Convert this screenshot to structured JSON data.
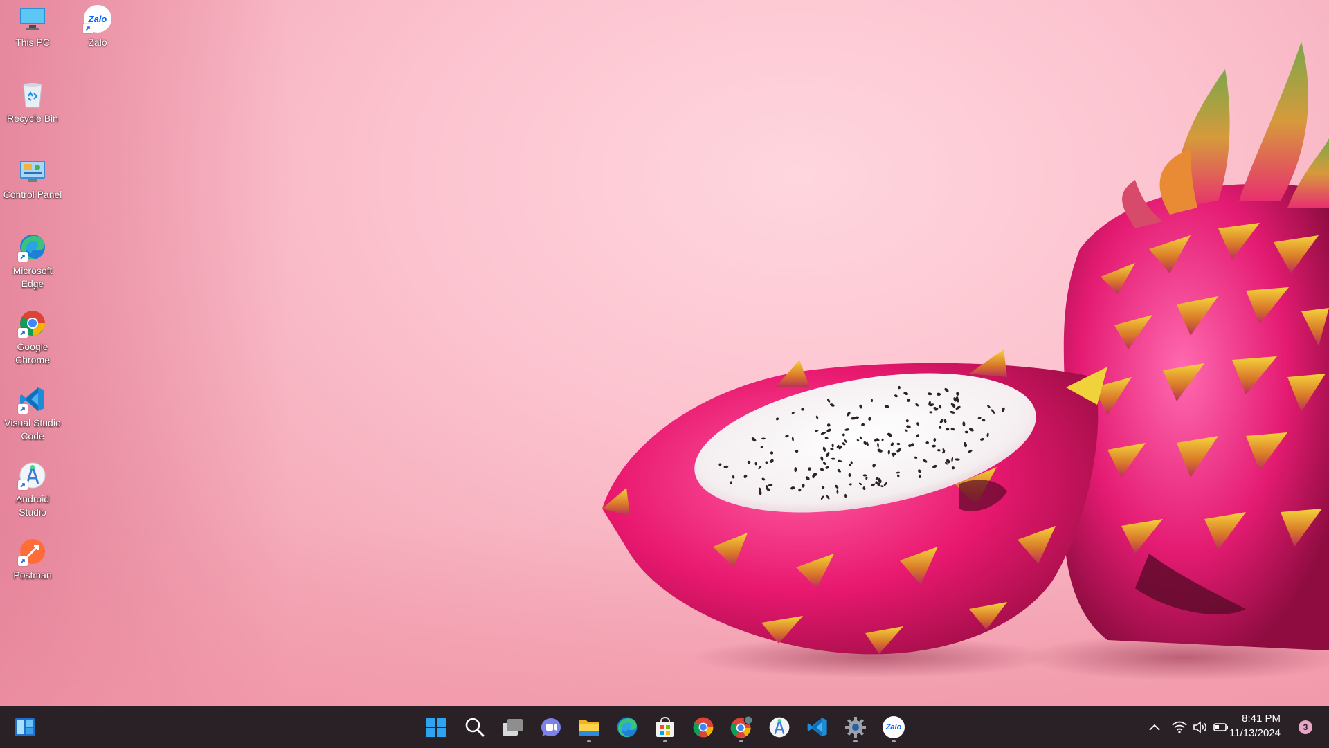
{
  "desktop": {
    "icons": [
      {
        "label": "This PC",
        "icon": "monitor-icon"
      },
      {
        "label": "Zalo",
        "icon": "zalo-icon",
        "badge_text": "Zalo"
      },
      {
        "label": "Recycle Bin",
        "icon": "recycle-bin-icon"
      },
      {
        "label": "Control Panel",
        "icon": "control-panel-icon"
      },
      {
        "label": "Microsoft\nEdge",
        "icon": "edge-icon"
      },
      {
        "label": "Google\nChrome",
        "icon": "chrome-icon"
      },
      {
        "label": "Visual Studio\nCode",
        "icon": "vscode-icon"
      },
      {
        "label": "Android\nStudio",
        "icon": "android-studio-icon"
      },
      {
        "label": "Postman",
        "icon": "postman-icon"
      }
    ]
  },
  "taskbar": {
    "widgets_icon": "widgets-icon",
    "apps": [
      {
        "name": "Start",
        "icon": "windows-start-icon"
      },
      {
        "name": "Search",
        "icon": "search-icon"
      },
      {
        "name": "Task View",
        "icon": "task-view-icon"
      },
      {
        "name": "Chat",
        "icon": "teams-chat-icon"
      },
      {
        "name": "File Explorer",
        "icon": "folder-icon",
        "running": true
      },
      {
        "name": "Microsoft Edge",
        "icon": "edge-icon"
      },
      {
        "name": "Microsoft Store",
        "icon": "store-icon",
        "running": true
      },
      {
        "name": "Google Chrome",
        "icon": "chrome-icon"
      },
      {
        "name": "Google Chrome profile",
        "icon": "chrome-profile-icon",
        "running": true
      },
      {
        "name": "Android Studio",
        "icon": "android-studio-icon"
      },
      {
        "name": "Visual Studio Code",
        "icon": "vscode-icon"
      },
      {
        "name": "Settings",
        "icon": "gear-icon",
        "running": true
      },
      {
        "name": "Zalo",
        "icon": "zalo-icon",
        "running": true,
        "badge_text": "Zalo"
      }
    ],
    "tray": {
      "overflow_icon": "chevron-up-icon",
      "wifi_icon": "wifi-icon",
      "volume_icon": "volume-icon",
      "battery_icon": "battery-icon",
      "time": "8:41 PM",
      "date": "11/13/2024",
      "notification_count": "3"
    }
  },
  "colors": {
    "taskbar_bg": "#2a2126",
    "wallpaper_pink": "#fcc3cf",
    "dragonfruit_skin": "#e8186f",
    "accent_blue": "#1e90e8"
  }
}
